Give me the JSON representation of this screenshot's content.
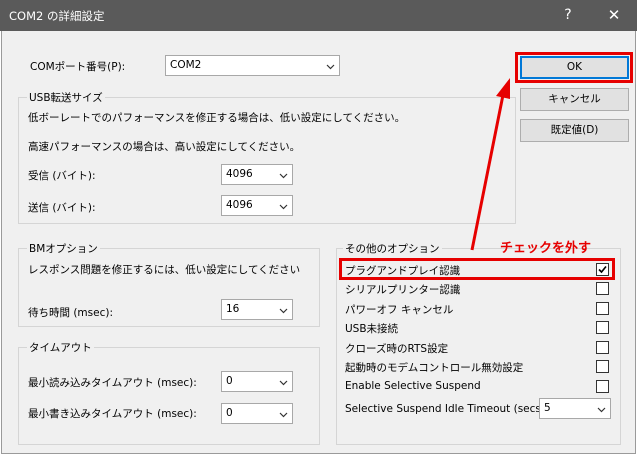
{
  "window": {
    "title": "COM2 の詳細設定",
    "help_glyph": "?",
    "close_glyph": "✕"
  },
  "port": {
    "label": "COMポート番号(P):",
    "value": "COM2"
  },
  "buttons": {
    "ok": "OK",
    "cancel": "キャンセル",
    "defaults": "既定値(D)"
  },
  "usb": {
    "title": "USB転送サイズ",
    "line1": "低ボーレートでのパフォーマンスを修正する場合は、低い設定にしてください。",
    "line2": "高速パフォーマンスの場合は、高い設定にしてください。",
    "receive_label": "受信 (バイト):",
    "receive_value": "4096",
    "transmit_label": "送信 (バイト):",
    "transmit_value": "4096"
  },
  "bm": {
    "title": "BMオプション",
    "desc": "レスポンス問題を修正するには、低い設定にしてください",
    "latency_label": "待ち時間 (msec):",
    "latency_value": "16"
  },
  "timeouts": {
    "title": "タイムアウト",
    "read_label": "最小読み込みタイムアウト (msec):",
    "read_value": "0",
    "write_label": "最小書き込みタイムアウト (msec):",
    "write_value": "0"
  },
  "misc": {
    "title": "その他のオプション",
    "options": [
      {
        "label": "プラグアンドプレイ認識",
        "checked": true
      },
      {
        "label": "シリアルプリンター認識",
        "checked": false
      },
      {
        "label": "パワーオフ キャンセル",
        "checked": false
      },
      {
        "label": "USB未接続",
        "checked": false
      },
      {
        "label": "クローズ時のRTS設定",
        "checked": false
      },
      {
        "label": "起動時のモデムコントロール無効設定",
        "checked": false
      },
      {
        "label": "Enable Selective Suspend",
        "checked": false
      }
    ],
    "suspend_timeout_label": "Selective Suspend Idle Timeout (secs):",
    "suspend_timeout_value": "5"
  },
  "annotation": {
    "text": "チェックを外す",
    "color": "#e60000"
  }
}
